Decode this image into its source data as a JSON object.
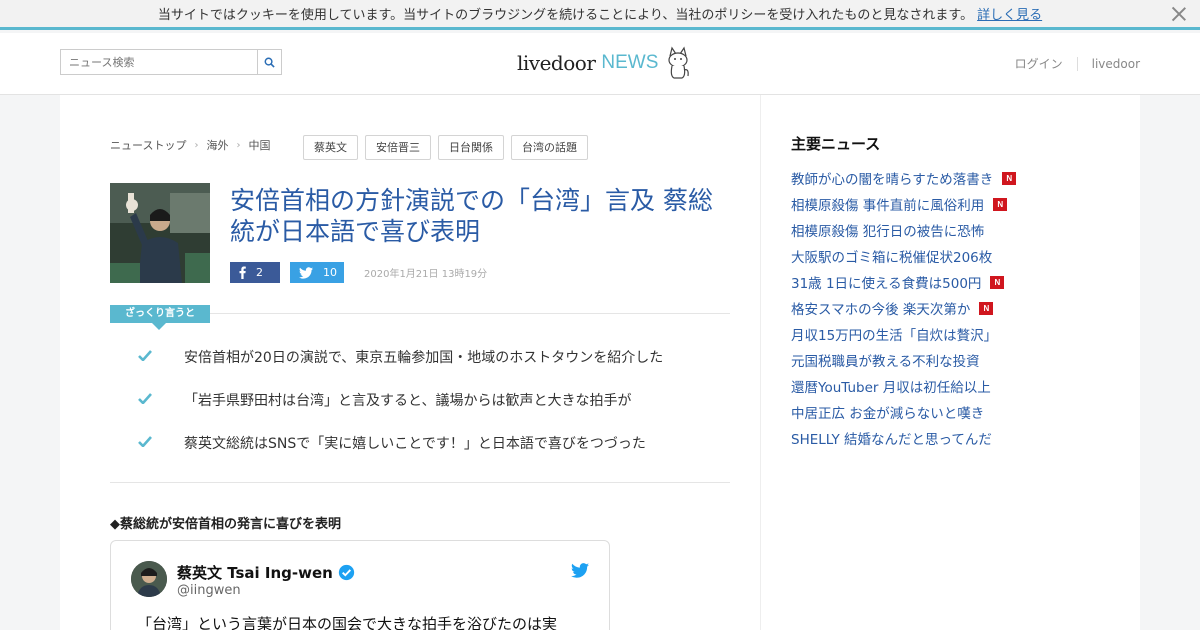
{
  "cookie": {
    "message": "当サイトではクッキーを使用しています。当サイトのブラウジングを続けることにより、当社のポリシーを受け入れたものと見なされます。",
    "more_link": "詳しく見る"
  },
  "header": {
    "search_placeholder": "ニュース検索",
    "logo_main": "livedoor",
    "logo_sub": "NEWS",
    "login": "ログイン",
    "livedoor_link": "livedoor"
  },
  "article": {
    "breadcrumbs": [
      "ニューストップ",
      "海外",
      "中国"
    ],
    "tags": [
      "蔡英文",
      "安倍晋三",
      "日台関係",
      "台湾の話題"
    ],
    "title": "安倍首相の方針演説での「台湾」言及 蔡総統が日本語で喜び表明",
    "facebook_count": "2",
    "twitter_count": "10",
    "date": "2020年1月21日 13時19分",
    "summary_label": "ざっくり言うと",
    "summary_points": [
      "安倍首相が20日の演説で、東京五輪参加国・地域のホストタウンを紹介した",
      "「岩手県野田村は台湾」と言及すると、議場からは歓声と大きな拍手が",
      "蔡英文総統はSNSで「実に嬉しいことです！」と日本語で喜びをつづった"
    ],
    "subheading": "◆蔡総統が安倍首相の発言に喜びを表明",
    "tweet": {
      "name": "蔡英文 Tsai Ing-wen",
      "handle": "@iingwen",
      "text": "「台湾」という言葉が日本の国会で大きな拍手を浴びたのは実"
    }
  },
  "sidebar": {
    "title": "主要ニュース",
    "items": [
      {
        "text": "教師が心の闇を晴らすため落書き",
        "new": true
      },
      {
        "text": "相模原殺傷 事件直前に風俗利用",
        "new": true
      },
      {
        "text": "相模原殺傷 犯行日の被告に恐怖",
        "new": false
      },
      {
        "text": "大阪駅のゴミ箱に税催促状206枚",
        "new": false
      },
      {
        "text": "31歳 1日に使える食費は500円",
        "new": true
      },
      {
        "text": "格安スマホの今後 楽天次第か",
        "new": true
      },
      {
        "text": "月収15万円の生活「自炊は贅沢」",
        "new": false
      },
      {
        "text": "元国税職員が教える不利な投資",
        "new": false
      },
      {
        "text": "還暦YouTuber 月収は初任給以上",
        "new": false
      },
      {
        "text": "中居正広 お金が減らないと嘆き",
        "new": false
      },
      {
        "text": "SHELLY 結婚なんだと思ってんだ",
        "new": false
      }
    ],
    "new_badge": "N"
  },
  "colors": {
    "accent": "#5ab8cf",
    "link": "#2a5ba5",
    "facebook": "#3b5a98",
    "twitter": "#39a1e4",
    "new_badge": "#d0161e"
  }
}
